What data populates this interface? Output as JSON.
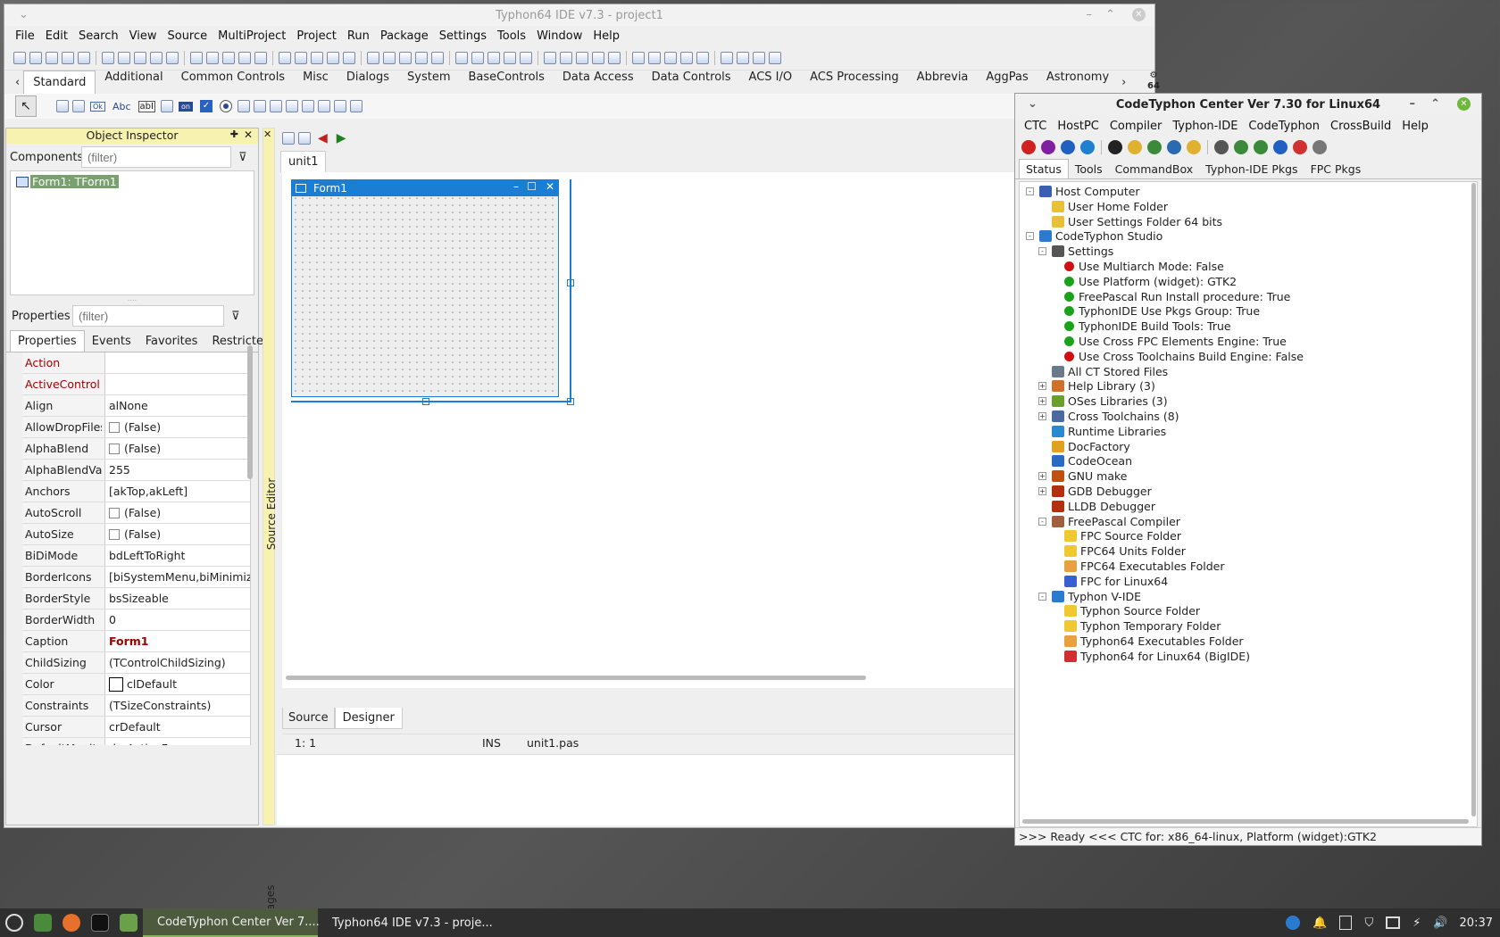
{
  "ide": {
    "title": "Typhon64 IDE v7.3 - project1",
    "menu": [
      "File",
      "Edit",
      "Search",
      "View",
      "Source",
      "MultiProject",
      "Project",
      "Run",
      "Package",
      "Settings",
      "Tools",
      "Window",
      "Help"
    ],
    "palette_tabs": [
      "Standard",
      "Additional",
      "Common Controls",
      "Misc",
      "Dialogs",
      "System",
      "BaseControls",
      "Data Access",
      "Data Controls",
      "ACS I/O",
      "ACS Processing",
      "Abbrevia",
      "AggPas",
      "Astronomy"
    ],
    "arch_badge": "64",
    "palette_items": [
      "Ok",
      "Abc",
      "abI",
      "on"
    ]
  },
  "inspector": {
    "title": "Object Inspector",
    "components_label": "Components",
    "filter_placeholder": "(filter)",
    "tree_item": "Form1: TForm1",
    "properties_label": "Properties",
    "tabs": [
      "Properties",
      "Events",
      "Favorites",
      "Restricted"
    ],
    "rows": [
      {
        "name": "Action",
        "value": "",
        "red": true
      },
      {
        "name": "ActiveControl",
        "value": "",
        "red": true
      },
      {
        "name": "Align",
        "value": "alNone"
      },
      {
        "name": "AllowDropFiles",
        "value": "(False)",
        "check": true
      },
      {
        "name": "AlphaBlend",
        "value": "(False)",
        "check": true
      },
      {
        "name": "AlphaBlendValue",
        "value": "255"
      },
      {
        "name": "Anchors",
        "value": "[akTop,akLeft]",
        "plus": true
      },
      {
        "name": "AutoScroll",
        "value": "(False)",
        "check": true
      },
      {
        "name": "AutoSize",
        "value": "(False)",
        "check": true
      },
      {
        "name": "BiDiMode",
        "value": "bdLeftToRight"
      },
      {
        "name": "BorderIcons",
        "value": "[biSystemMenu,biMinimize,biMaximize]",
        "plus": true
      },
      {
        "name": "BorderStyle",
        "value": "bsSizeable"
      },
      {
        "name": "BorderWidth",
        "value": "0"
      },
      {
        "name": "Caption",
        "value": "Form1",
        "bold": true
      },
      {
        "name": "ChildSizing",
        "value": "(TControlChildSizing)",
        "plus": true
      },
      {
        "name": "Color",
        "value": "clDefault",
        "color": true
      },
      {
        "name": "Constraints",
        "value": "(TSizeConstraints)",
        "plus": true
      },
      {
        "name": "Cursor",
        "value": "crDefault"
      },
      {
        "name": "DefaultMonitor",
        "value": "dmActiveForm"
      }
    ]
  },
  "editor": {
    "tab": "unit1",
    "form_caption": "Form1",
    "bottom_tabs": [
      "Source",
      "Designer"
    ],
    "status": {
      "pos": "1:  1",
      "mode": "INS",
      "file": "unit1.pas"
    },
    "source_editor_label": "Source Editor",
    "messages_label": "Messages"
  },
  "ctc": {
    "title": "CodeTyphon Center Ver 7.30 for Linux64",
    "menu": [
      "CTC",
      "HostPC",
      "Compiler",
      "Typhon-IDE",
      "CodeTyphon",
      "CrossBuild",
      "Help"
    ],
    "tabs": [
      "Status",
      "Tools",
      "CommandBox",
      "Typhon-IDE Pkgs",
      "FPC Pkgs"
    ],
    "tree": [
      {
        "label": "Host Computer",
        "level": 0,
        "exp": "-",
        "icon": "computer-icon",
        "color": "#3a5fb0"
      },
      {
        "label": "User Home Folder",
        "level": 1,
        "icon": "home-folder-icon",
        "color": "#e8c13a"
      },
      {
        "label": "User Settings Folder 64 bits",
        "level": 1,
        "icon": "settings-folder-icon",
        "color": "#e8c13a"
      },
      {
        "label": "CodeTyphon Studio",
        "level": 0,
        "exp": "-",
        "icon": "typhon-icon",
        "color": "#2a7ad0"
      },
      {
        "label": "Settings",
        "level": 1,
        "exp": "-",
        "icon": "tools-icon",
        "color": "#555"
      },
      {
        "label": "Use Multiarch Mode: False",
        "level": 2,
        "dot": "#d01010"
      },
      {
        "label": "Use Platform (widget): GTK2",
        "level": 2,
        "dot": "#1aa31a"
      },
      {
        "label": "FreePascal Run Install procedure: True",
        "level": 2,
        "dot": "#1aa31a"
      },
      {
        "label": "TyphonIDE Use Pkgs Group: True",
        "level": 2,
        "dot": "#1aa31a"
      },
      {
        "label": "TyphonIDE Build Tools: True",
        "level": 2,
        "dot": "#1aa31a"
      },
      {
        "label": "Use Cross FPC Elements Engine: True",
        "level": 2,
        "dot": "#1aa31a"
      },
      {
        "label": "Use Cross Toolchains Build Engine: False",
        "level": 2,
        "dot": "#d01010"
      },
      {
        "label": "All CT Stored Files",
        "level": 1,
        "icon": "database-icon",
        "color": "#6a7a8a"
      },
      {
        "label": "Help Library (3)",
        "level": 1,
        "exp": "+",
        "icon": "book-icon",
        "color": "#d0702a"
      },
      {
        "label": "OSes Libraries (3)",
        "level": 1,
        "exp": "+",
        "icon": "library-icon",
        "color": "#6aa02a"
      },
      {
        "label": "Cross Toolchains (8)",
        "level": 1,
        "exp": "+",
        "icon": "gear-icon",
        "color": "#4a6aa0"
      },
      {
        "label": "Runtime Libraries",
        "level": 1,
        "icon": "runner-icon",
        "color": "#2a8ad0"
      },
      {
        "label": "DocFactory",
        "level": 1,
        "icon": "lock-icon",
        "color": "#e0a020"
      },
      {
        "label": "CodeOcean",
        "level": 1,
        "icon": "wave-icon",
        "color": "#2a6ac0"
      },
      {
        "label": "GNU make",
        "level": 1,
        "exp": "+",
        "icon": "gnu-icon",
        "color": "#c05010"
      },
      {
        "label": "GDB Debugger",
        "level": 1,
        "exp": "+",
        "icon": "bug-icon",
        "color": "#b03010"
      },
      {
        "label": "LLDB Debugger",
        "level": 1,
        "icon": "bug-icon",
        "color": "#b03010"
      },
      {
        "label": "FreePascal Compiler",
        "level": 1,
        "exp": "-",
        "icon": "compiler-icon",
        "color": "#a06040"
      },
      {
        "label": "FPC Source Folder",
        "level": 2,
        "icon": "folder-icon",
        "color": "#f0c830"
      },
      {
        "label": "FPC64 Units Folder",
        "level": 2,
        "icon": "units-folder-icon",
        "color": "#f0c830"
      },
      {
        "label": "FPC64 Executables Folder",
        "level": 2,
        "icon": "exe-folder-icon",
        "color": "#e8a040"
      },
      {
        "label": "FPC for Linux64",
        "level": 2,
        "icon": "gear-icon",
        "color": "#3a5fd0"
      },
      {
        "label": "Typhon V-IDE",
        "level": 1,
        "exp": "-",
        "icon": "typhon-icon",
        "color": "#2a7ad0"
      },
      {
        "label": "Typhon Source Folder",
        "level": 2,
        "icon": "folder-icon",
        "color": "#f0c830"
      },
      {
        "label": "Typhon Temporary Folder",
        "level": 2,
        "icon": "folder-icon",
        "color": "#f0c830"
      },
      {
        "label": "Typhon64 Executables Folder",
        "level": 2,
        "icon": "exe-folder-icon",
        "color": "#e8a040"
      },
      {
        "label": "Typhon64 for Linux64 (BigIDE)",
        "level": 2,
        "icon": "typhon64-icon",
        "color": "#d03030"
      }
    ],
    "status": ">>> Ready <<<  CTC for: x86_64-linux, Platform (widget):GTK2"
  },
  "taskbar": {
    "items": [
      "CodeTyphon Center Ver 7....",
      "Typhon64 IDE v7.3 - proje..."
    ],
    "clock": "20:37"
  }
}
